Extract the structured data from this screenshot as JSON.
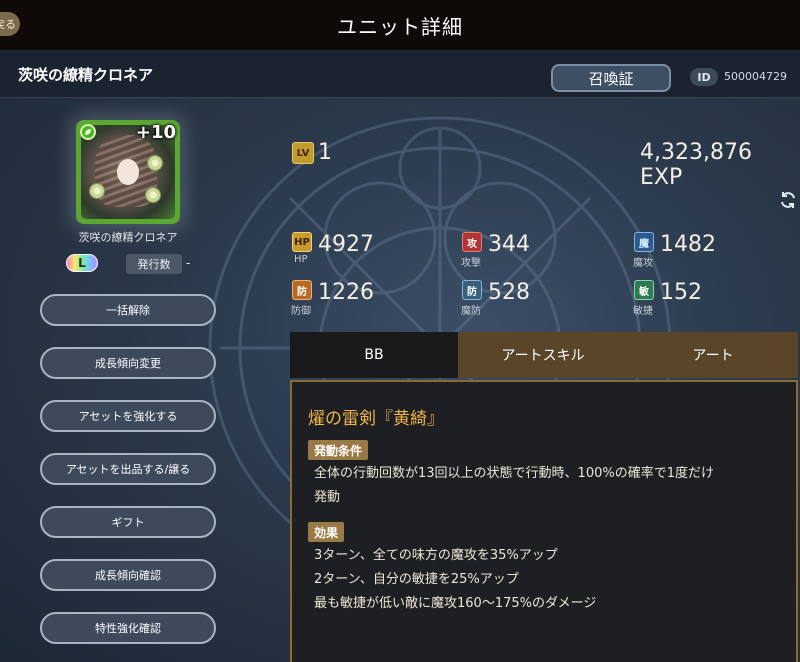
{
  "header": {
    "back_label": "戻る",
    "title": "ユニット詳細"
  },
  "unit": {
    "name": "茨咲の繚精クロネア",
    "summon_button": "召喚証",
    "id_label": "ID",
    "id_value": "500004729",
    "plus": "+10",
    "portrait_name": "茨咲の繚精クロネア",
    "rarity": "L",
    "issue_label": "発行数",
    "issue_value": "-"
  },
  "side_buttons": [
    "一括解除",
    "成長傾向変更",
    "アセットを強化する",
    "アセットを出品する/譲る",
    "ギフト",
    "成長傾向確認",
    "特性強化確認"
  ],
  "level": {
    "icon": "LV",
    "value": "1",
    "exp": "4,323,876 EXP"
  },
  "stats": {
    "hp": {
      "icon": "HP",
      "label": "HP",
      "value": "4927"
    },
    "atk": {
      "icon": "攻",
      "label": "攻撃",
      "value": "344"
    },
    "mag": {
      "icon": "魔",
      "label": "魔攻",
      "value": "1482"
    },
    "def": {
      "icon": "防",
      "label": "防御",
      "value": "1226"
    },
    "mdef": {
      "icon": "防",
      "label": "魔防",
      "value": "528"
    },
    "agi": {
      "icon": "敏",
      "label": "敏捷",
      "value": "152"
    }
  },
  "tabs": [
    {
      "label": "BB",
      "active": true
    },
    {
      "label": "アートスキル",
      "active": false
    },
    {
      "label": "アート",
      "active": false
    }
  ],
  "skill": {
    "name": "燿の雷剣『黄綺』",
    "condition_tag": "発動条件",
    "condition_lines": [
      "全体の行動回数が13回以上の状態で行動時、100%の確率で1度だけ",
      "発動"
    ],
    "effect_tag": "効果",
    "effect_lines": [
      "3ターン、全ての味方の魔攻を35%アップ",
      "2ターン、自分の敏捷を25%アップ",
      "最も敏捷が低い敵に魔攻160〜175%のダメージ"
    ]
  },
  "icons": {
    "element": "leaf-element-icon",
    "refresh": "refresh-icon"
  }
}
